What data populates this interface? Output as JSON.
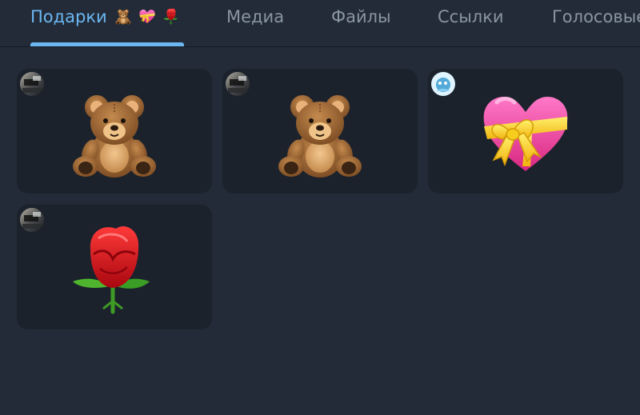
{
  "tabs": [
    {
      "label": "Подарки",
      "active": true,
      "emoji_icons": [
        "teddy-bear-icon",
        "heart-with-ribbon-icon",
        "rose-icon"
      ]
    },
    {
      "label": "Медиа",
      "active": false
    },
    {
      "label": "Файлы",
      "active": false
    },
    {
      "label": "Ссылки",
      "active": false
    },
    {
      "label": "Голосовые",
      "active": false
    }
  ],
  "gifts": [
    {
      "item": "teddy-bear",
      "sender_avatar": "photo-avatar"
    },
    {
      "item": "teddy-bear",
      "sender_avatar": "photo-avatar"
    },
    {
      "item": "heart-with-ribbon",
      "sender_avatar": "cartoon-avatar"
    },
    {
      "item": "rose",
      "sender_avatar": "photo-avatar"
    }
  ],
  "colors": {
    "background": "#222b37",
    "card": "#1b222c",
    "accent": "#6cb7f2",
    "inactive_tab": "#8a95a3"
  }
}
